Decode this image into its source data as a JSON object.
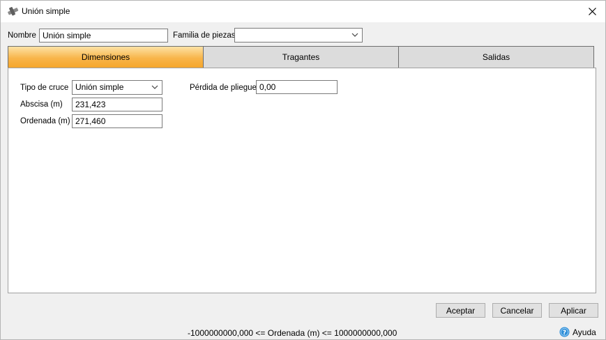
{
  "window": {
    "title": "Unión simple"
  },
  "header": {
    "name_label": "Nombre",
    "name_value": "Unión simple",
    "family_label": "Familia de piezas",
    "family_value": ""
  },
  "tabs": [
    {
      "label": "Dimensiones",
      "active": true
    },
    {
      "label": "Tragantes",
      "active": false
    },
    {
      "label": "Salidas",
      "active": false
    }
  ],
  "dimensions": {
    "cross_type_label": "Tipo de cruce",
    "cross_type_value": "Unión simple",
    "abscissa_label": "Abscisa (m)",
    "abscissa_value": "231,423",
    "ordinate_label": "Ordenada (m)",
    "ordinate_value": "271,460",
    "loss_label": "Pérdida de pliegue",
    "loss_value": "0,00"
  },
  "buttons": {
    "accept": "Aceptar",
    "cancel": "Cancelar",
    "apply": "Aplicar"
  },
  "status": {
    "text": "-1000000000,000 <= Ordenada (m) <= 1000000000,000"
  },
  "help": {
    "label": "Ayuda"
  },
  "colors": {
    "active_tab": "#f5a62c",
    "inactive_tab": "#dcdcdc",
    "help_icon": "#2f8fd8"
  }
}
